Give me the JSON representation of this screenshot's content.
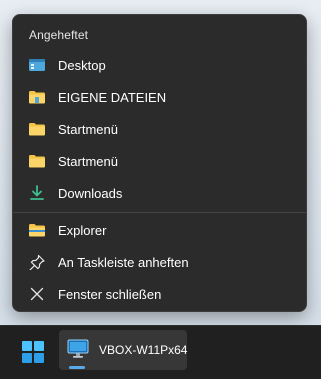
{
  "jumplist": {
    "header": "Angeheftet",
    "items": [
      {
        "label": "Desktop",
        "icon": "desktop-folder-icon"
      },
      {
        "label": "EIGENE DATEIEN",
        "icon": "folder-icon"
      },
      {
        "label": "Startmenü",
        "icon": "folder-icon"
      },
      {
        "label": "Startmenü",
        "icon": "folder-icon"
      },
      {
        "label": "Downloads",
        "icon": "download-icon"
      }
    ],
    "actions": [
      {
        "label": "Explorer",
        "icon": "file-explorer-icon"
      },
      {
        "label": "An Taskleiste anheften",
        "icon": "pin-icon"
      },
      {
        "label": "Fenster schließen",
        "icon": "close-icon"
      }
    ]
  },
  "taskbar": {
    "start_icon": "windows-start-icon",
    "app": {
      "label": "VBOX-W11Px64",
      "icon": "monitor-icon"
    }
  },
  "colors": {
    "menu_bg": "#2b2b2b",
    "taskbar_bg": "#202020",
    "folder_yellow": "#f6c445",
    "download_green": "#3fbf8f",
    "accent_blue": "#5aa9e6"
  }
}
